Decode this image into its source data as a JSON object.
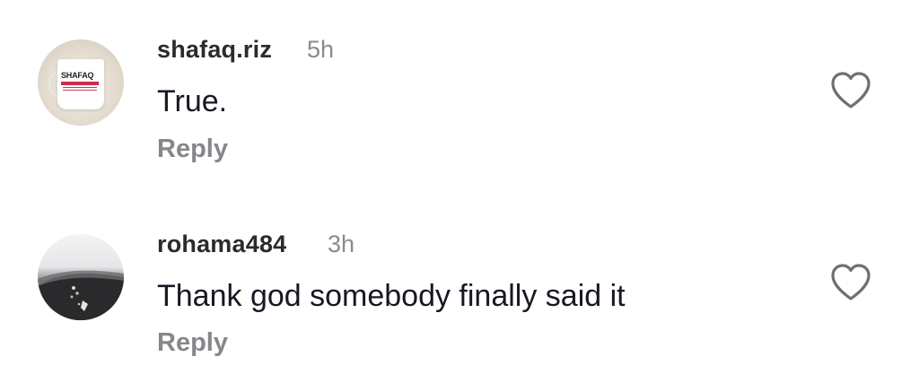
{
  "comments": [
    {
      "username": "shafaq.riz",
      "timestamp": "5h",
      "text": "True.",
      "reply_label": "Reply",
      "avatar_logo_text": "SHAFAQ",
      "like_icon": "heart-outline-icon"
    },
    {
      "username": "rohama484",
      "timestamp": "3h",
      "text": "Thank god somebody finally said it",
      "reply_label": "Reply",
      "like_icon": "heart-outline-icon"
    }
  ],
  "colors": {
    "username": "#2b2b2f",
    "timestamp": "#8a8b91",
    "text": "#161823",
    "reply": "#86878b",
    "icon": "#6f7075",
    "mug_stripe": "#d22a4b"
  }
}
